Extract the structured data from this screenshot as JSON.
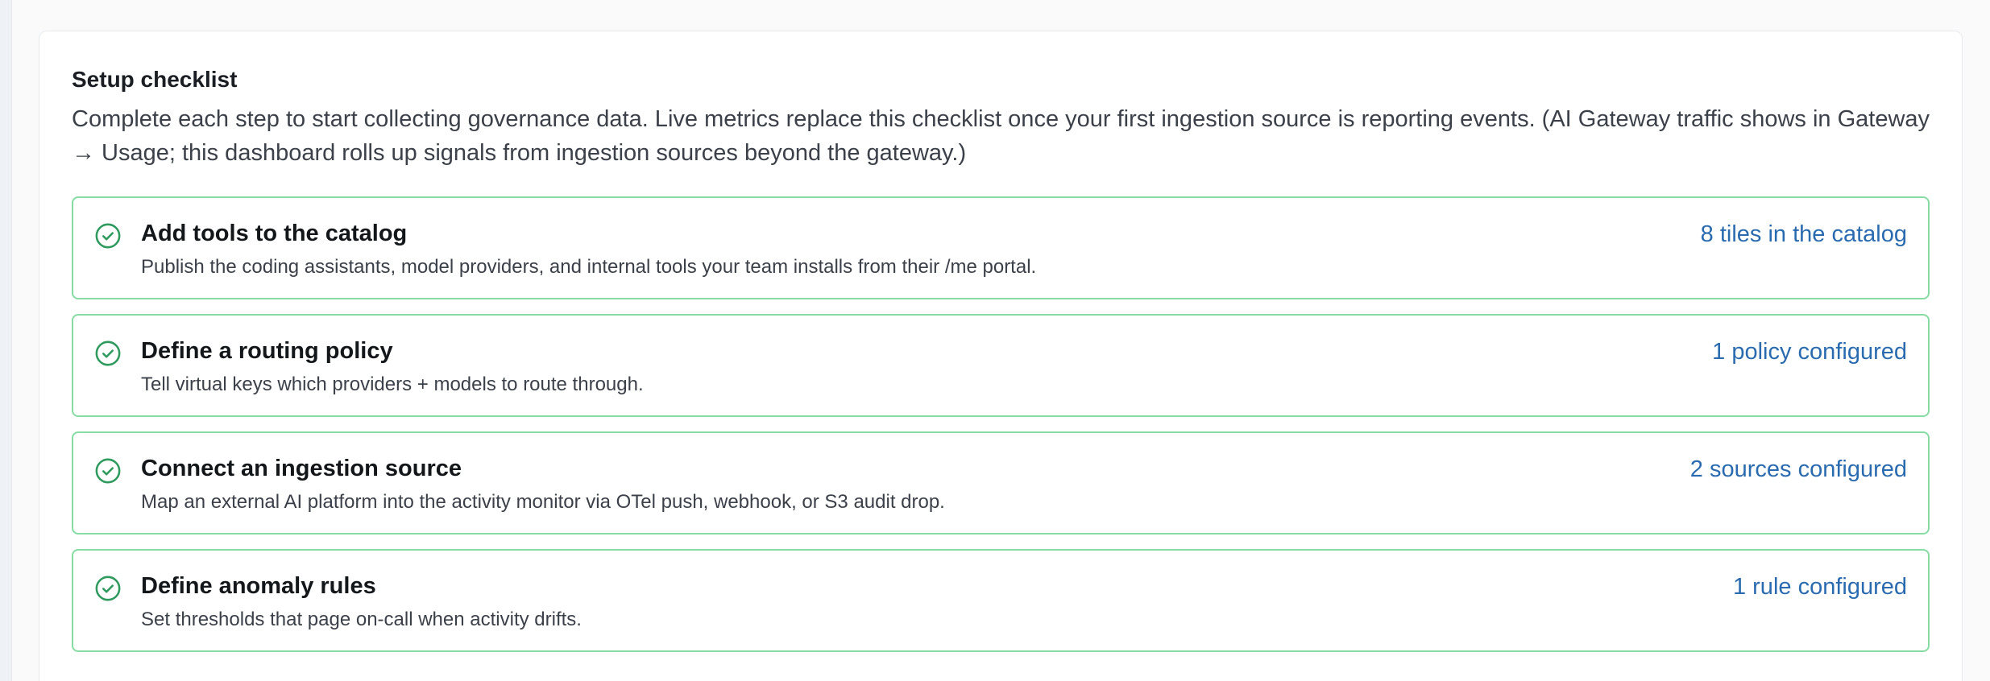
{
  "checklist": {
    "title": "Setup checklist",
    "description": "Complete each step to start collecting governance data. Live metrics replace this checklist once your first ingestion source is reporting events. (AI Gateway traffic shows in Gateway → Usage; this dashboard rolls up signals from ingestion sources beyond the gateway.)",
    "steps": [
      {
        "title": "Add tools to the catalog",
        "description": "Publish the coding assistants, model providers, and internal tools your team installs from their /me portal.",
        "status": "8 tiles in the catalog",
        "icon": "check-circle-icon",
        "complete": true
      },
      {
        "title": "Define a routing policy",
        "description": "Tell virtual keys which providers + models to route through.",
        "status": "1 policy configured",
        "icon": "check-circle-icon",
        "complete": true
      },
      {
        "title": "Connect an ingestion source",
        "description": "Map an external AI platform into the activity monitor via OTel push, webhook, or S3 audit drop.",
        "status": "2 sources configured",
        "icon": "check-circle-icon",
        "complete": true
      },
      {
        "title": "Define anomaly rules",
        "description": "Set thresholds that page on-call when activity drifts.",
        "status": "1 rule configured",
        "icon": "check-circle-icon",
        "complete": true
      }
    ]
  },
  "colors": {
    "complete_border": "#86dca2",
    "complete_icon": "#2e9a5e",
    "status_link": "#2a6bb0"
  }
}
